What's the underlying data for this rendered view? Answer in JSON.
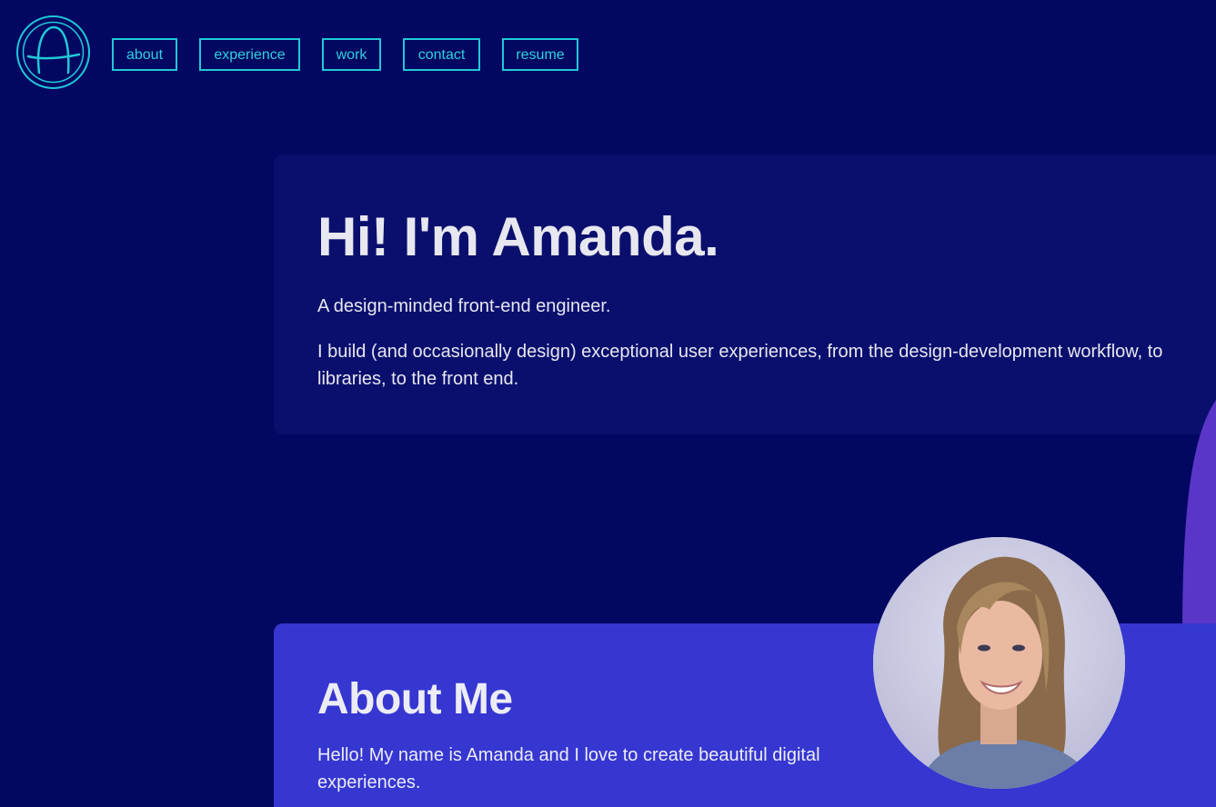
{
  "header": {
    "logo_icon": "letter-a-circle-logo",
    "nav": [
      {
        "label": "about"
      },
      {
        "label": "experience"
      },
      {
        "label": "work"
      },
      {
        "label": "contact"
      },
      {
        "label": "resume"
      }
    ]
  },
  "hero": {
    "title": "Hi! I'm Amanda.",
    "subtitle": "A design-minded front-end engineer.",
    "body": "I build (and occasionally design) exceptional user experiences, from the design-development workflow, to libraries, to the front end."
  },
  "about": {
    "title": "About Me",
    "body": "Hello! My name is Amanda and I love to create beautiful digital experiences.",
    "avatar_icon": "profile-photo"
  },
  "colors": {
    "background": "#020761",
    "accent": "#21c8d8",
    "hero_card": "#0a0f6e",
    "about_card": "#3636d1",
    "swoosh": "#5a36c8",
    "text": "#e7e7ef"
  }
}
